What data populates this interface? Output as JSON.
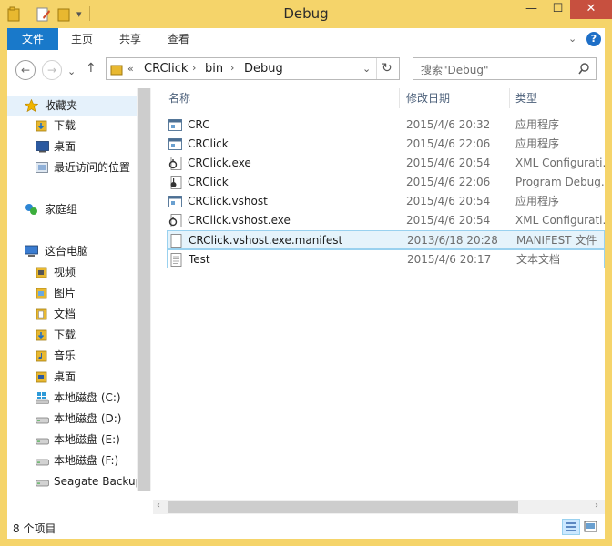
{
  "window": {
    "title": "Debug",
    "minimize": "—",
    "maximize": "☐",
    "close": "✕"
  },
  "ribbon": {
    "tabs": [
      "文件",
      "主页",
      "共享",
      "查看"
    ]
  },
  "nav_buttons": {
    "back": "←",
    "forward": "→",
    "up": "↑",
    "refresh": "↻"
  },
  "address": {
    "prefix": "«",
    "crumbs": [
      "CRClick",
      "bin",
      "Debug"
    ],
    "separator": "›"
  },
  "search": {
    "placeholder": "搜索\"Debug\""
  },
  "sidebar": {
    "items": [
      {
        "label": "收藏夹",
        "icon": "star-icon"
      },
      {
        "label": "下载",
        "icon": "downloads-folder-icon"
      },
      {
        "label": "桌面",
        "icon": "desktop-icon"
      },
      {
        "label": "最近访问的位置",
        "icon": "recent-places-icon"
      },
      {
        "label": "家庭组",
        "icon": "homegroup-icon"
      },
      {
        "label": "这台电脑",
        "icon": "computer-icon"
      },
      {
        "label": "视频",
        "icon": "videos-folder-icon"
      },
      {
        "label": "图片",
        "icon": "pictures-folder-icon"
      },
      {
        "label": "文档",
        "icon": "documents-folder-icon"
      },
      {
        "label": "下载",
        "icon": "downloads-folder-icon"
      },
      {
        "label": "音乐",
        "icon": "music-folder-icon"
      },
      {
        "label": "桌面",
        "icon": "desktop-folder-icon"
      },
      {
        "label": "本地磁盘 (C:)",
        "icon": "windows-drive-icon"
      },
      {
        "label": "本地磁盘 (D:)",
        "icon": "drive-icon"
      },
      {
        "label": "本地磁盘 (E:)",
        "icon": "drive-icon"
      },
      {
        "label": "本地磁盘 (F:)",
        "icon": "drive-icon"
      },
      {
        "label": "Seagate Backup",
        "icon": "drive-icon"
      }
    ]
  },
  "columns": {
    "name": "名称",
    "date": "修改日期",
    "type": "类型"
  },
  "files": [
    {
      "name": "CRC",
      "date": "2015/4/6 20:32",
      "type": "应用程序",
      "icon": "application-icon"
    },
    {
      "name": "CRClick",
      "date": "2015/4/6 22:06",
      "type": "应用程序",
      "icon": "application-icon"
    },
    {
      "name": "CRClick.exe",
      "date": "2015/4/6 20:54",
      "type": "XML Configurati...",
      "icon": "config-file-icon"
    },
    {
      "name": "CRClick",
      "date": "2015/4/6 22:06",
      "type": "Program Debug...",
      "icon": "debug-database-icon"
    },
    {
      "name": "CRClick.vshost",
      "date": "2015/4/6 20:54",
      "type": "应用程序",
      "icon": "application-icon"
    },
    {
      "name": "CRClick.vshost.exe",
      "date": "2015/4/6 20:54",
      "type": "XML Configurati...",
      "icon": "config-file-icon"
    },
    {
      "name": "CRClick.vshost.exe.manifest",
      "date": "2013/6/18 20:28",
      "type": "MANIFEST 文件",
      "icon": "manifest-file-icon"
    },
    {
      "name": "Test",
      "date": "2015/4/6 20:17",
      "type": "文本文档",
      "icon": "text-file-icon"
    }
  ],
  "status": {
    "count": "8 个项目"
  },
  "colors": {
    "accent": "#1979ca",
    "frame": "#f5d46a",
    "selection": "#e5f3fb",
    "selection_border": "#99d1ef"
  }
}
